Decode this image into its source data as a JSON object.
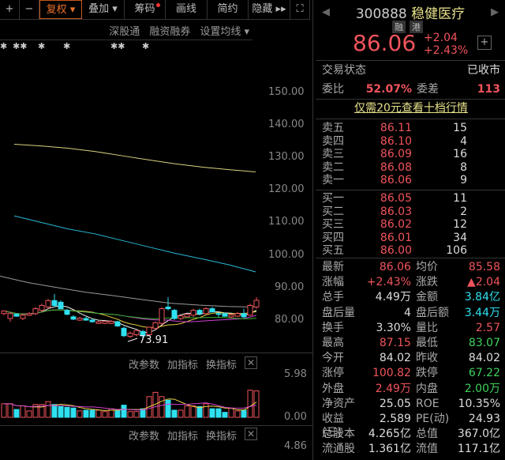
{
  "toolbar": {
    "plus": "+",
    "minus": "−",
    "fuquan": "复权 ▾",
    "diejia": "叠加 ▾",
    "chouma": "筹码",
    "huaxian": "画线",
    "jianyue": "简约",
    "yincang": "隐藏 ▸▸",
    "fullscreen": "⛶"
  },
  "subbar": {
    "a": "深股通",
    "b": "融资融券",
    "c": "设置均线 ▾"
  },
  "markers": [
    "✱",
    "✱✱",
    "✱",
    "✱",
    "✱✱",
    "✱"
  ],
  "price_axis": [
    "150.00",
    "140.00",
    "130.00",
    "120.00",
    "110.00",
    "100.00",
    "90.00",
    "80.00"
  ],
  "low_label": "73.91",
  "indicator1": {
    "a": "改参数",
    "b": "加指标",
    "c": "换指标",
    "close": "✕",
    "max": "5.98",
    "min": "0.00"
  },
  "indicator2": {
    "a": "改参数",
    "b": "加指标",
    "c": "换指标",
    "close": "✕",
    "max": "4.86"
  },
  "chart_data": {
    "type": "candlestick",
    "ohlc": [
      [
        82,
        83,
        81.5,
        82.8
      ],
      [
        80.5,
        82.5,
        79.5,
        82
      ],
      [
        81.8,
        82,
        81,
        81.2
      ],
      [
        80.5,
        82,
        80,
        81.5
      ],
      [
        81.5,
        82.5,
        81.2,
        82
      ],
      [
        82,
        84,
        81.5,
        83.5
      ],
      [
        83,
        85,
        82.5,
        84.5
      ],
      [
        84,
        86.5,
        83.5,
        86
      ],
      [
        86,
        88,
        84,
        84.5
      ],
      [
        85.5,
        86,
        83.5,
        83.5
      ],
      [
        83,
        83.5,
        81.5,
        81.8
      ],
      [
        81,
        81.5,
        80,
        80.3
      ],
      [
        80,
        81,
        79.8,
        80.6
      ],
      [
        80.5,
        81,
        79.8,
        80
      ],
      [
        80,
        80.5,
        79.2,
        79.5
      ],
      [
        79,
        79.8,
        78.8,
        79.5
      ],
      [
        79,
        79.8,
        78.8,
        79.6
      ],
      [
        79,
        80,
        78.8,
        79.6
      ],
      [
        79.5,
        79.8,
        78,
        78.2
      ],
      [
        77.5,
        78,
        74.8,
        75.2
      ],
      [
        75,
        76.5,
        74.5,
        76
      ],
      [
        75.5,
        77,
        75,
        76.8
      ],
      [
        76.5,
        77,
        73.91,
        75.2
      ],
      [
        75.5,
        78,
        75.3,
        77.8
      ],
      [
        77.5,
        79.5,
        77,
        79.2
      ],
      [
        79,
        84,
        78.5,
        83.5
      ],
      [
        84,
        87,
        83,
        83.5
      ],
      [
        83,
        83.5,
        80,
        80.5
      ],
      [
        80.5,
        81.5,
        80,
        81.3
      ],
      [
        81,
        82,
        80.8,
        81.8
      ],
      [
        81.5,
        83.5,
        81,
        83
      ],
      [
        83,
        83.5,
        81.5,
        82
      ],
      [
        82,
        84,
        81.8,
        83.5
      ],
      [
        83.5,
        84,
        82.5,
        82.5
      ],
      [
        82,
        82.5,
        81,
        81.8
      ],
      [
        82,
        82.3,
        81,
        81.2
      ],
      [
        81,
        82,
        80.6,
        81.6
      ],
      [
        81.2,
        82.5,
        81,
        82
      ],
      [
        82,
        83.5,
        80.6,
        81
      ],
      [
        81.5,
        85,
        81.3,
        84.5
      ],
      [
        84,
        87,
        83.5,
        86.06
      ]
    ],
    "volume": [
      1.9,
      1.9,
      1.1,
      1.6,
      0.9,
      1.8,
      1.8,
      2.2,
      1.8,
      1.5,
      1.4,
      1.3,
      0.9,
      1.0,
      1.0,
      1.0,
      0.8,
      1.2,
      1.0,
      1.7,
      0.8,
      0.8,
      1.2,
      2.9,
      3.5,
      2.9,
      2.4,
      1.0,
      1.0,
      1.6,
      1.6,
      1.5,
      1.9,
      1.2,
      1.2,
      0.7,
      1.3,
      0.9,
      1.0,
      3.8,
      3.7
    ],
    "ma_long": {
      "yellow": [
        134,
        133.5,
        132.8,
        131.8,
        130.5,
        129.2,
        128,
        127,
        126.2,
        125.5
      ],
      "cyan": [
        112,
        110,
        108,
        106.5,
        104.5,
        102.5,
        100.5,
        98.8,
        97,
        94.8
      ],
      "gray": [
        93.5,
        91.5,
        90,
        88.6,
        87.5,
        86.3,
        85.2,
        84.6,
        84.2,
        84.0
      ]
    },
    "ylim": [
      72,
      152
    ],
    "vol_ylim": [
      0,
      5.98
    ]
  },
  "quote": {
    "code": "300888",
    "name": "稳健医疗",
    "tag1": "融",
    "tag2": "港",
    "price": "86.06",
    "change": "+2.04",
    "pct": "+2.43%",
    "plus": "+"
  },
  "status": {
    "label": "交易状态",
    "value": "已收市",
    "wb_label": "委比",
    "wb": "52.07%",
    "wc_label": "委差",
    "wc": "113",
    "promo": "仅需20元查看十档行情"
  },
  "asks": [
    {
      "l": "卖五",
      "p": "86.11",
      "v": "15"
    },
    {
      "l": "卖四",
      "p": "86.10",
      "v": "4"
    },
    {
      "l": "卖三",
      "p": "86.09",
      "v": "16"
    },
    {
      "l": "卖二",
      "p": "86.08",
      "v": "8"
    },
    {
      "l": "卖一",
      "p": "86.06",
      "v": "9"
    }
  ],
  "bids": [
    {
      "l": "买一",
      "p": "86.05",
      "v": "11"
    },
    {
      "l": "买二",
      "p": "86.03",
      "v": "2"
    },
    {
      "l": "买三",
      "p": "86.02",
      "v": "12"
    },
    {
      "l": "买四",
      "p": "86.01",
      "v": "34"
    },
    {
      "l": "买五",
      "p": "86.00",
      "v": "106"
    }
  ],
  "stats": [
    {
      "a": "最新",
      "b": "86.06",
      "bc": "red",
      "c": "均价",
      "d": "85.58",
      "dc": "red"
    },
    {
      "a": "涨幅",
      "b": "+2.43%",
      "bc": "red",
      "c": "涨跌",
      "d": "▲2.04",
      "dc": "red"
    },
    {
      "a": "总手",
      "b": "4.49万",
      "bc": "white",
      "c": "金额",
      "d": "3.84亿",
      "dc": "cyan"
    },
    {
      "a": "盘后量",
      "b": "4",
      "bc": "white",
      "c": "盘后额",
      "d": "3.44万",
      "dc": "cyan"
    },
    {
      "a": "换手",
      "b": "3.30%",
      "bc": "white",
      "c": "量比",
      "d": "2.57",
      "dc": "red"
    },
    {
      "a": "最高",
      "b": "87.15",
      "bc": "red",
      "c": "最低",
      "d": "83.07",
      "dc": "green"
    },
    {
      "a": "今开",
      "b": "84.02",
      "bc": "white",
      "c": "昨收",
      "d": "84.02",
      "dc": "white"
    },
    {
      "a": "涨停",
      "b": "100.82",
      "bc": "red",
      "c": "跌停",
      "d": "67.22",
      "dc": "green"
    },
    {
      "a": "外盘",
      "b": "2.49万",
      "bc": "red",
      "c": "内盘",
      "d": "2.00万",
      "dc": "green"
    },
    {
      "a": "净资产",
      "b": "25.05",
      "bc": "white",
      "c": "ROE",
      "d": "10.35%",
      "dc": "white"
    },
    {
      "a": "收益(三)",
      "b": "2.589",
      "bc": "white",
      "c": "PE(动)",
      "d": "24.93",
      "dc": "white"
    },
    {
      "a": "总股本",
      "b": "4.265亿",
      "bc": "white",
      "c": "总值",
      "d": "367.0亿",
      "dc": "white"
    },
    {
      "a": "流通股",
      "b": "1.361亿",
      "bc": "white",
      "c": "流值",
      "d": "117.1亿",
      "dc": "white"
    }
  ],
  "colors": {
    "up": "#f0545c",
    "down": "#2ee0f0",
    "accent": "#e8712a"
  }
}
